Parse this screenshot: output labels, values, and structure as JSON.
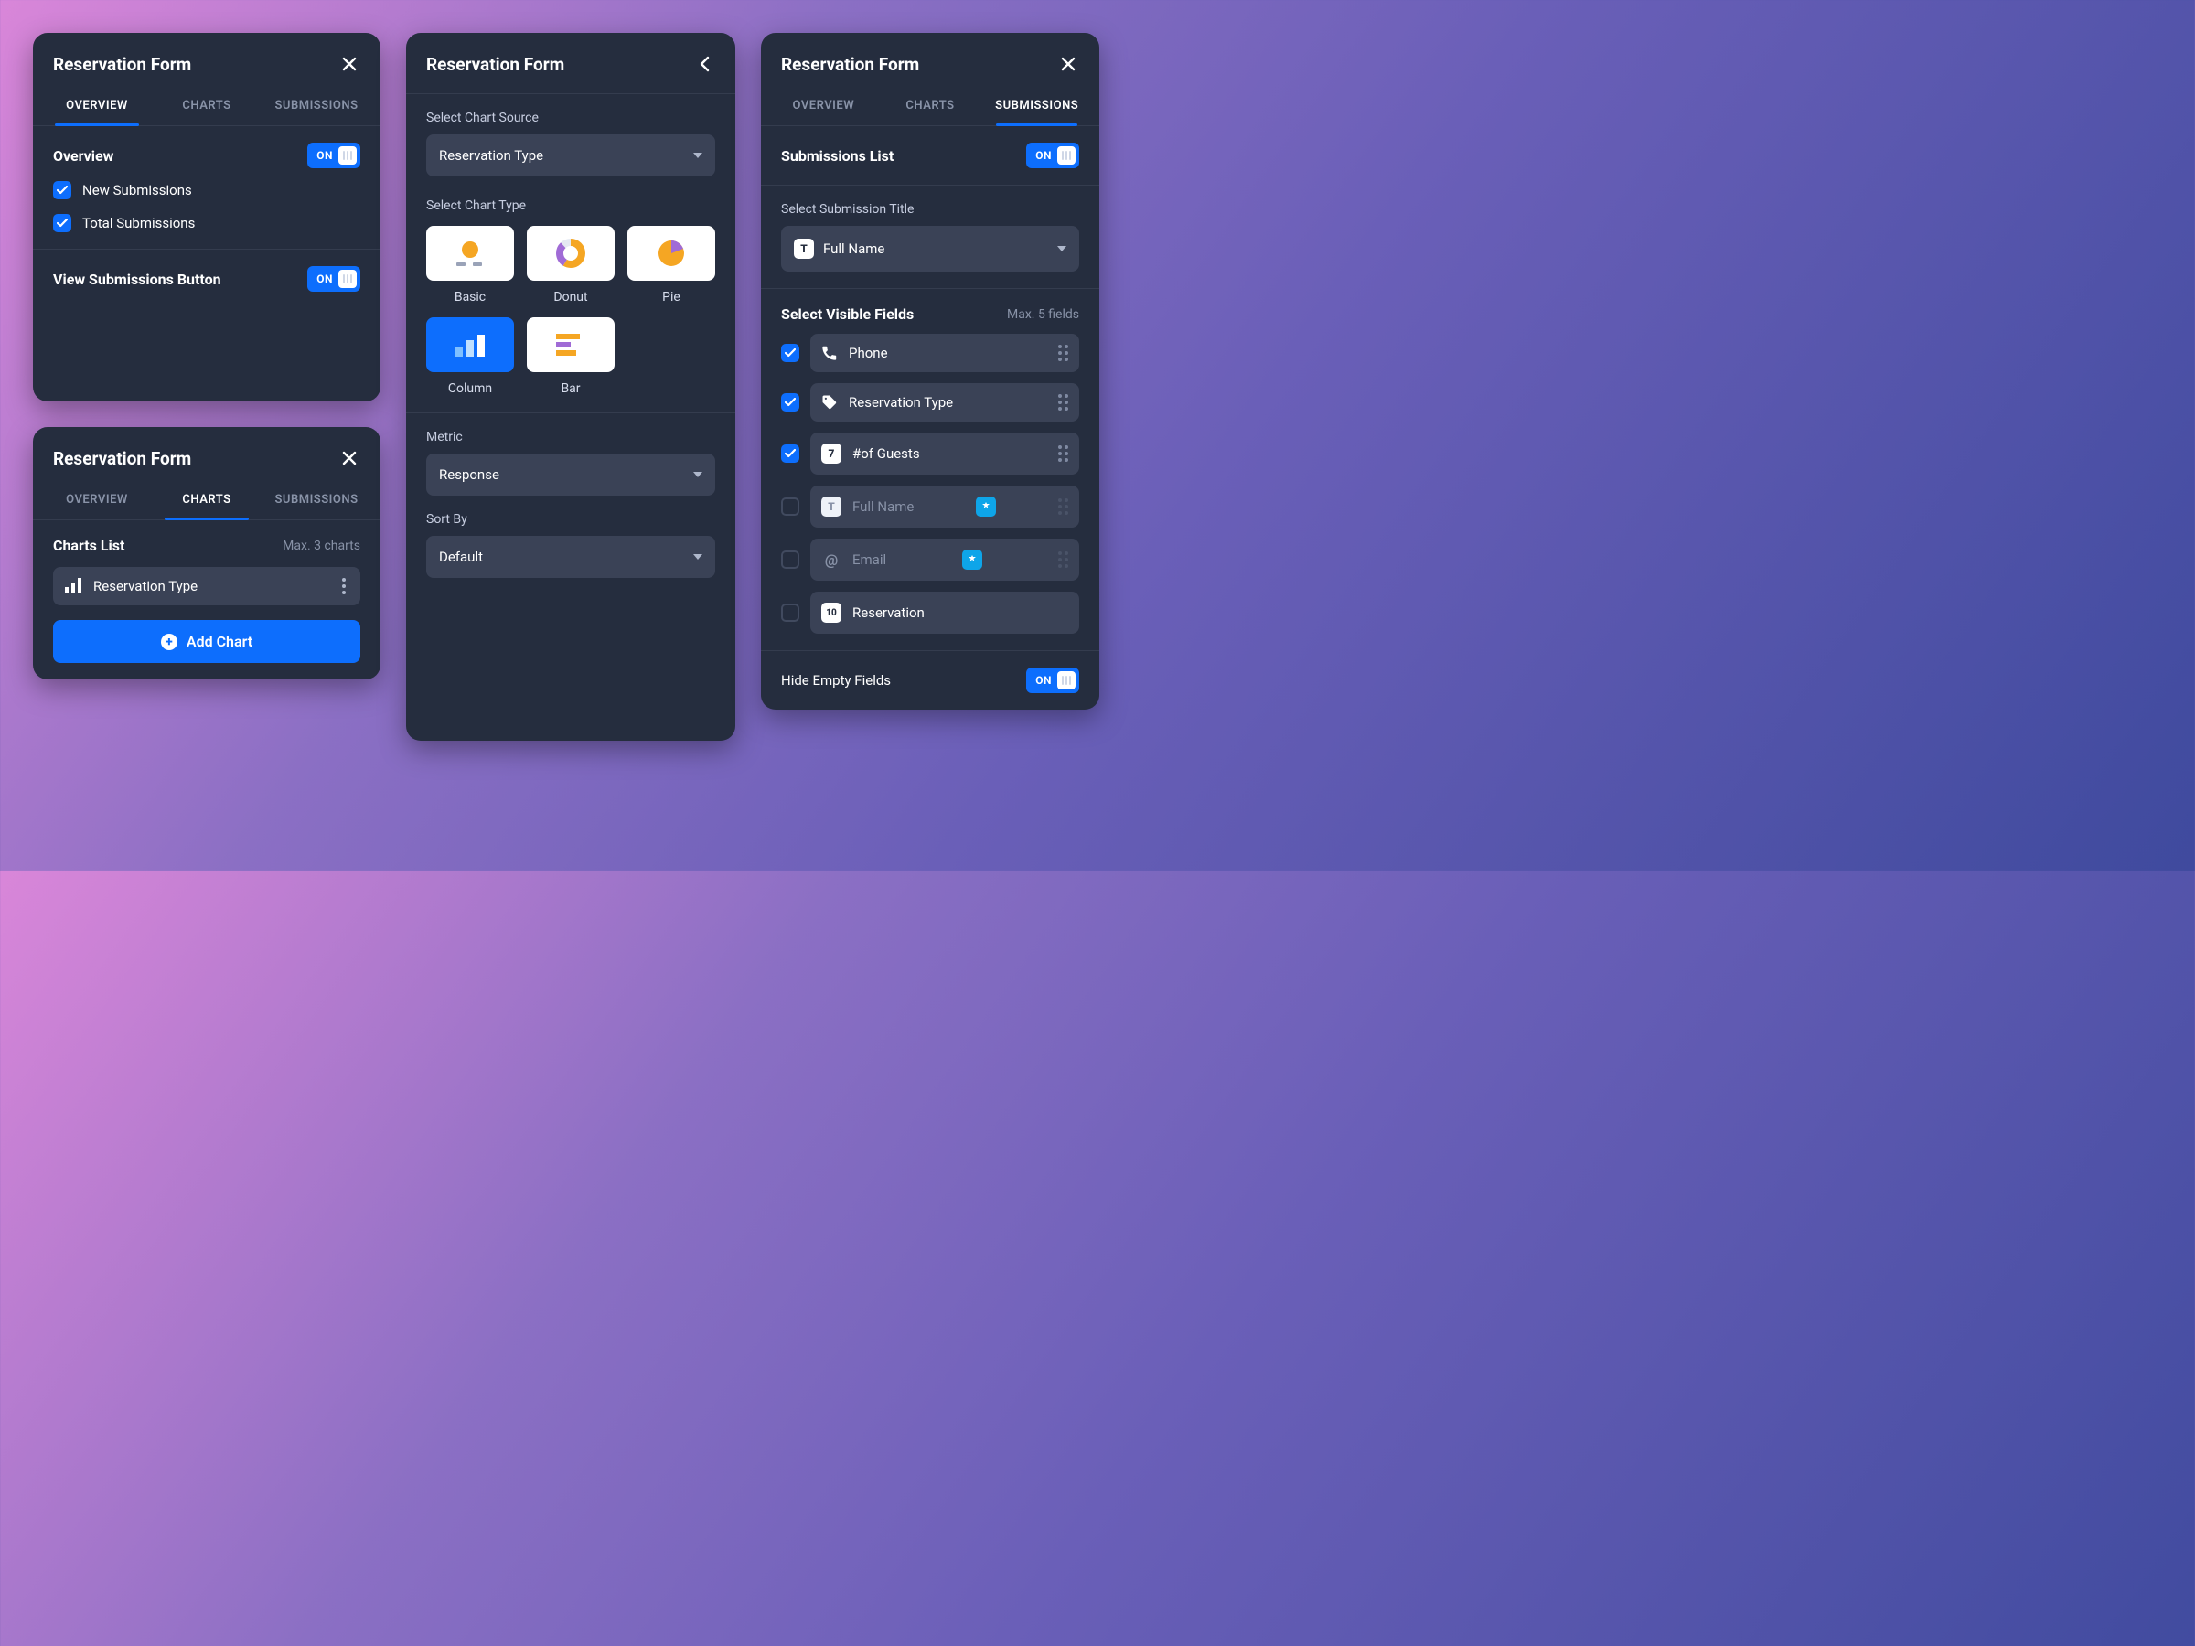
{
  "panel_title": "Reservation Form",
  "tabs": {
    "overview": "OVERVIEW",
    "charts": "CHARTS",
    "submissions": "SUBMISSIONS"
  },
  "toggle_on": "ON",
  "overview": {
    "section1_title": "Overview",
    "opt_new": "New Submissions",
    "opt_total": "Total Submissions",
    "section2_title": "View Submissions Button"
  },
  "charts_panel": {
    "list_title": "Charts List",
    "list_hint": "Max. 3 charts",
    "item1_label": "Reservation Type",
    "add_btn": "Add Chart"
  },
  "chart_config": {
    "source_label": "Select Chart Source",
    "source_value": "Reservation Type",
    "type_label": "Select Chart Type",
    "types": {
      "basic": "Basic",
      "donut": "Donut",
      "pie": "Pie",
      "column": "Column",
      "bar": "Bar"
    },
    "metric_label": "Metric",
    "metric_value": "Response",
    "sort_label": "Sort By",
    "sort_value": "Default"
  },
  "submissions": {
    "list_title": "Submissions List",
    "title_label": "Select Submission Title",
    "title_value": "Full Name",
    "fields_label": "Select Visible Fields",
    "fields_hint": "Max. 5 fields",
    "fields": {
      "phone": "Phone",
      "res_type": "Reservation Type",
      "guests": "#of Guests",
      "guests_icon": "7",
      "full_name": "Full Name",
      "email": "Email",
      "reservation": "Reservation",
      "reservation_day": "10"
    },
    "hide_empty": "Hide Empty Fields"
  }
}
